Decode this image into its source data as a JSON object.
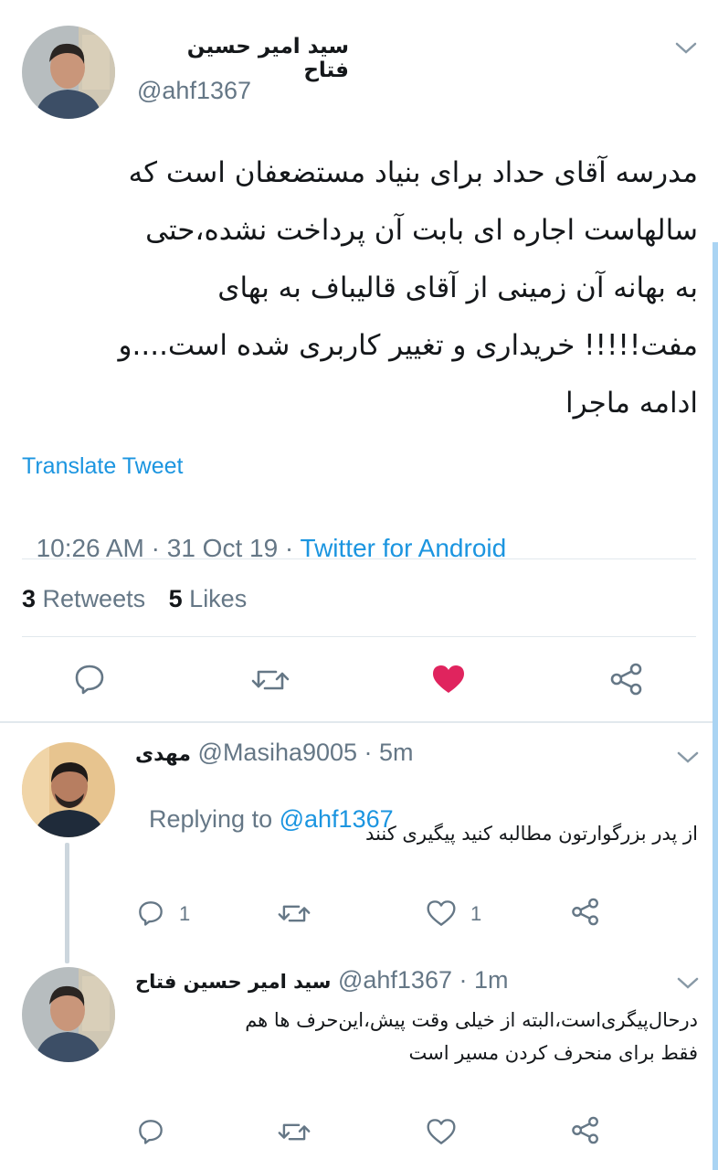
{
  "colors": {
    "accent": "#1b95e0",
    "like": "#e0245e",
    "muted": "#657786",
    "text": "#14171a",
    "divider": "#e1e8ed"
  },
  "main_tweet": {
    "display_name": "سید امیر حسین فتاح",
    "handle": "@ahf1367",
    "text_lines": [
      "مدرسه آقای حداد برای بنیاد مستضعفان است که",
      "سالهاست اجاره ای بابت آن پرداخت نشده،حتی",
      "به بهانه آن زمینی از آقای قالیباف به بهای",
      "مفت!!!!! خریداری و تغییر کاربری شده است....و",
      "ادامه ماجرا"
    ],
    "translate_label": "Translate Tweet",
    "timestamp": "10:26 AM · 31 Oct 19 · ",
    "source": "Twitter for Android",
    "retweets_count": "3",
    "retweets_label": "Retweets",
    "likes_count": "5",
    "likes_label": "Likes",
    "liked": true
  },
  "replies": [
    {
      "display_name": "مهدی",
      "meta": "@Masiha9005 · 5m",
      "replying_prefix": "Replying to ",
      "replying_to": "@ahf1367",
      "text_lines": [
        "از پدر بزرگوارتون مطالبه کنید پیگیری کنند"
      ],
      "reply_count": "1",
      "like_count": "1"
    },
    {
      "display_name": "سید امیر حسین فتاح",
      "meta": "@ahf1367 · 1m",
      "text_lines": [
        "درحال‌پیگری‌است،البته از خیلی وقت پیش،این‌حرف ها هم",
        "فقط برای منحرف کردن مسیر است"
      ]
    }
  ],
  "icons": {
    "reply": "reply-icon",
    "retweet": "retweet-icon",
    "like": "heart-icon",
    "share": "share-icon",
    "more": "chevron-down-icon"
  }
}
